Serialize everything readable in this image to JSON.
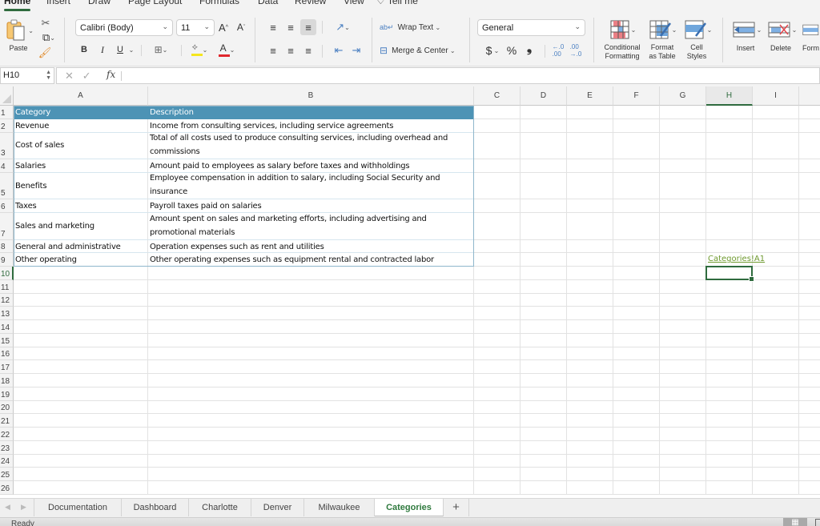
{
  "ribbon_tabs": [
    {
      "label": "Home",
      "active": true
    },
    {
      "label": "Insert"
    },
    {
      "label": "Draw"
    },
    {
      "label": "Page Layout"
    },
    {
      "label": "Formulas"
    },
    {
      "label": "Data"
    },
    {
      "label": "Review"
    },
    {
      "label": "View"
    },
    {
      "label": "Tell me"
    }
  ],
  "ribbon": {
    "paste_label": "Paste",
    "font_name": "Calibri (Body)",
    "font_size": "11",
    "bold": "B",
    "italic": "I",
    "underline": "U",
    "wrap_text": "Wrap Text",
    "merge_center": "Merge & Center",
    "number_format": "General",
    "currency": "$",
    "percent": "%",
    "comma": "❟",
    "conditional_formatting": [
      "Conditional",
      "Formatting"
    ],
    "format_as_table": [
      "Format",
      "as Table"
    ],
    "cell_styles": [
      "Cell",
      "Styles"
    ],
    "insert": "Insert",
    "delete": "Delete",
    "format": "Form",
    "accent_color": "#2f6b3e",
    "highlight_color": "#f5e61d",
    "font_color": "#e0282e"
  },
  "formula_bar": {
    "name_box": "H10",
    "fx": "fx",
    "formula": ""
  },
  "columns": [
    "A",
    "B",
    "C",
    "D",
    "E",
    "F",
    "G",
    "H",
    "I"
  ],
  "selected_column": "H",
  "selected_row": "10",
  "rows": [
    "1",
    "2",
    "3",
    "4",
    "5",
    "6",
    "7",
    "8",
    "9",
    "10",
    "11",
    "12",
    "13",
    "14",
    "15",
    "16",
    "17",
    "18",
    "19",
    "20",
    "21",
    "22",
    "23",
    "24",
    "25",
    "26"
  ],
  "table": {
    "header": {
      "category": "Category",
      "description": "Description"
    },
    "header_color": "#4d93b5",
    "rows": [
      {
        "category": "Revenue",
        "description": [
          "Income from consulting services, including service agreements"
        ]
      },
      {
        "category": "Cost of sales",
        "description": [
          "Total of all costs used to produce consulting services, including overhead and",
          "commissions"
        ]
      },
      {
        "category": "Salaries",
        "description": [
          "Amount paid to employees as salary before taxes and withholdings"
        ]
      },
      {
        "category": "Benefits",
        "description": [
          "Employee compensation in addition to salary, including Social Security and",
          "insurance"
        ]
      },
      {
        "category": "Taxes",
        "description": [
          "Payroll taxes paid on salaries"
        ]
      },
      {
        "category": "Sales and marketing",
        "description": [
          "Amount spent on sales and marketing efforts, including advertising and",
          "promotional materials"
        ]
      },
      {
        "category": "General and administrative",
        "description": [
          "Operation expenses such as rent and utilities"
        ]
      },
      {
        "category": "Other operating",
        "description": [
          "Other operating expenses such as equipment rental and contracted labor"
        ]
      }
    ]
  },
  "h9_link": "Categories!A1",
  "sheet_tabs": [
    {
      "label": "Documentation"
    },
    {
      "label": "Dashboard"
    },
    {
      "label": "Charlotte"
    },
    {
      "label": "Denver"
    },
    {
      "label": "Milwaukee"
    },
    {
      "label": "Categories",
      "active": true
    }
  ],
  "add_sheet": "+",
  "status": "Ready"
}
